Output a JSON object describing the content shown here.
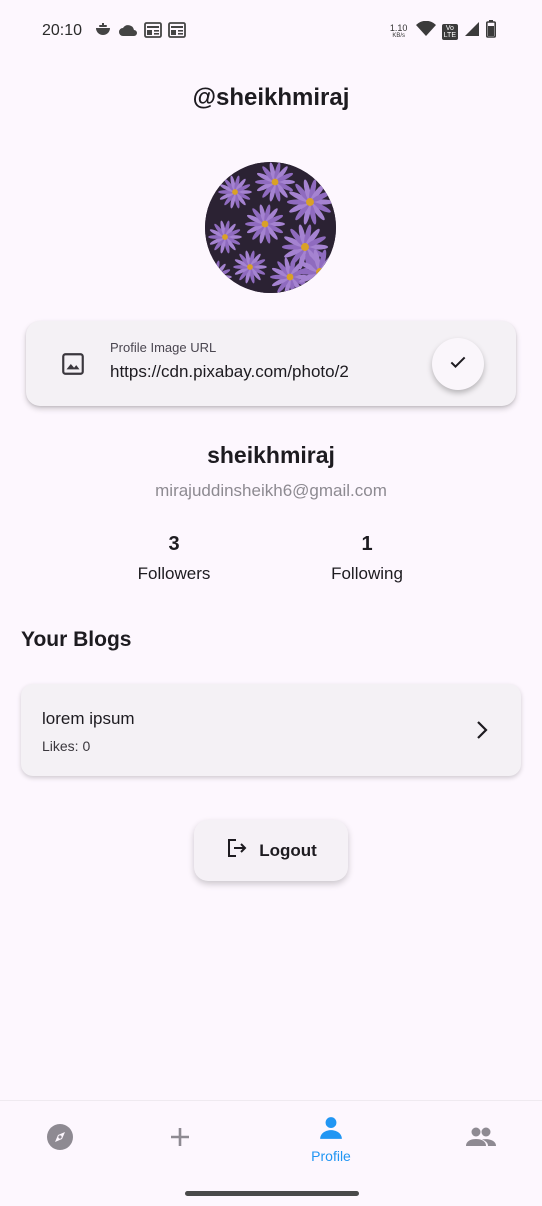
{
  "status_bar": {
    "time": "20:10",
    "network_speed_value": "1.10",
    "network_speed_unit": "KB/s",
    "volte_top": "Vo",
    "volte_bottom": "LTE",
    "icons": [
      "notification-icon",
      "cloud-icon",
      "news-icon",
      "news-icon",
      "wifi-icon",
      "signal-icon",
      "battery-icon"
    ]
  },
  "header": {
    "username": "@sheikhmiraj"
  },
  "profile_image_field": {
    "label": "Profile Image URL",
    "value": "https://cdn.pixabay.com/photo/2",
    "leading_icon": "image-icon",
    "confirm_icon": "check-icon"
  },
  "user": {
    "name": "sheikhmiraj",
    "email": "mirajuddinsheikh6@gmail.com"
  },
  "stats": {
    "followers_count": "3",
    "followers_label": "Followers",
    "following_count": "1",
    "following_label": "Following"
  },
  "blogs": {
    "section_title": "Your Blogs",
    "items": [
      {
        "title": "lorem ipsum",
        "likes": "Likes: 0"
      }
    ]
  },
  "logout": {
    "label": "Logout"
  },
  "bottom_nav": {
    "items": [
      {
        "icon": "compass-icon",
        "label": ""
      },
      {
        "icon": "plus-icon",
        "label": ""
      },
      {
        "icon": "person-icon",
        "label": "Profile",
        "active": true
      },
      {
        "icon": "people-icon",
        "label": ""
      }
    ],
    "active_color": "#2196f3",
    "inactive_color": "#8e8a92"
  }
}
